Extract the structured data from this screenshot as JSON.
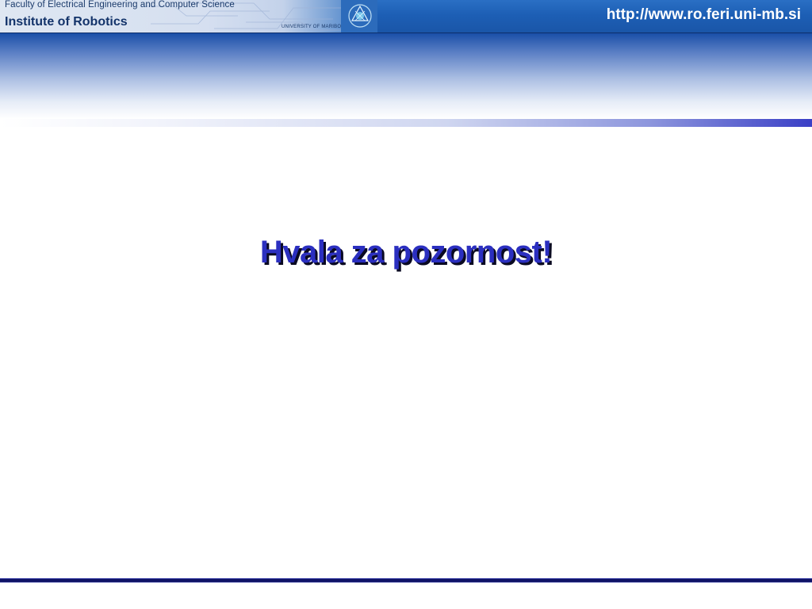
{
  "header": {
    "faculty": "Faculty of Electrical Engineering and Computer Science",
    "institute": "Institute of Robotics",
    "university": "UNIVERSITY OF MARIBOR",
    "url": "http://www.ro.feri.uni-mb.si",
    "logo_icon": "university-logo-icon"
  },
  "slide": {
    "title": "Hvala za pozornost!"
  },
  "colors": {
    "header_blue": "#1d5fb5",
    "title_blue": "#2b2fc0",
    "bottom_line": "#0e1266"
  }
}
